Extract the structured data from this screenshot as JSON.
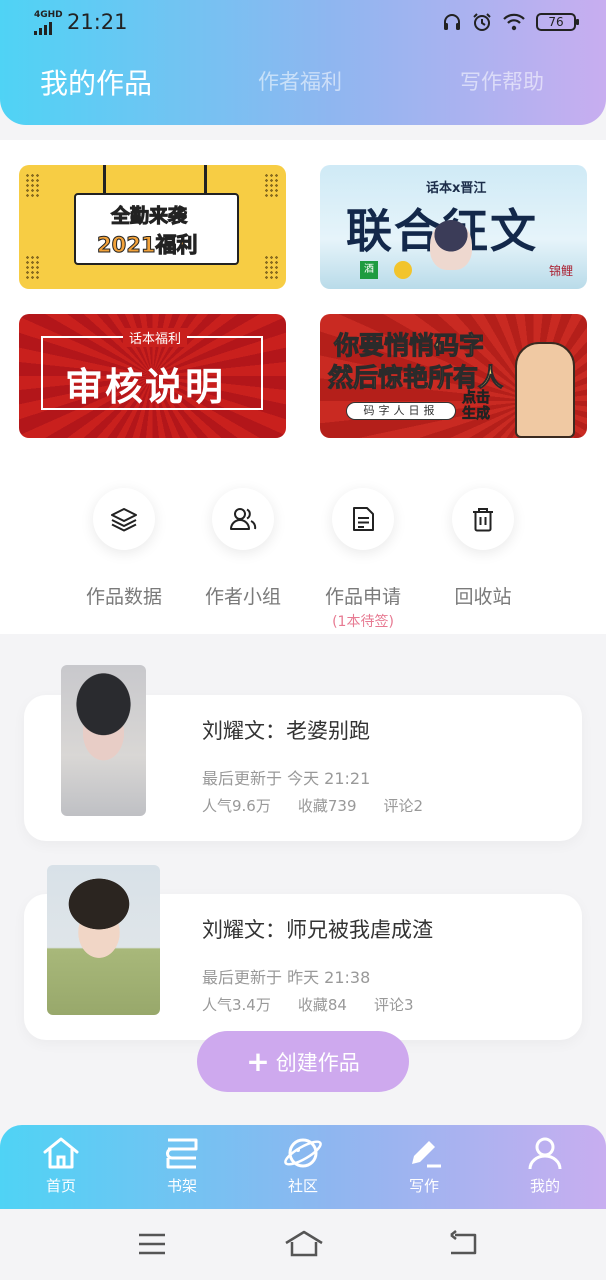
{
  "status_bar": {
    "network": "4GHD",
    "time": "21:21",
    "battery": "76"
  },
  "header_tabs": [
    {
      "label": "我的作品",
      "active": true
    },
    {
      "label": "作者福利",
      "active": false
    },
    {
      "label": "写作帮助",
      "active": false
    }
  ],
  "banners": [
    {
      "name": "attendance-banner",
      "line1": "全勤来袭",
      "line2": "2021福利"
    },
    {
      "name": "collab-banner",
      "line1": "话本x晋江",
      "line2": "联合征文",
      "logo": "酒",
      "signature": "锦鲤"
    },
    {
      "name": "review-banner",
      "line1": "话本福利",
      "line2": "审核说明"
    },
    {
      "name": "daily-banner",
      "line1": "你要悄悄码字",
      "line2": "然后惊艳所有人",
      "tag": "码字人日报",
      "cta": "点击生成"
    }
  ],
  "actions": [
    {
      "label": "作品数据",
      "icon": "layers-icon"
    },
    {
      "label": "作者小组",
      "icon": "group-icon"
    },
    {
      "label": "作品申请",
      "icon": "document-icon",
      "sub": "(1本待签)"
    },
    {
      "label": "回收站",
      "icon": "trash-icon"
    }
  ],
  "works": [
    {
      "title": "刘耀文：老婆别跑",
      "updated": "最后更新于 今天 21:21",
      "popularity": "人气9.6万",
      "favorites": "收藏739",
      "comments": "评论2"
    },
    {
      "title": "刘耀文：师兄被我虐成渣",
      "updated": "最后更新于 昨天 21:38",
      "popularity": "人气3.4万",
      "favorites": "收藏84",
      "comments": "评论3"
    }
  ],
  "create_button": {
    "plus": "+",
    "label": "创建作品"
  },
  "bottom_nav": [
    {
      "label": "首页",
      "icon": "home-icon"
    },
    {
      "label": "书架",
      "icon": "bookshelf-icon"
    },
    {
      "label": "社区",
      "icon": "planet-icon"
    },
    {
      "label": "写作",
      "icon": "pen-icon"
    },
    {
      "label": "我的",
      "icon": "user-icon"
    }
  ],
  "colors": {
    "gradient_start": "#4fd3f5",
    "gradient_end": "#c8aef0",
    "create_button": "#cea9ee",
    "pending_text": "#e77a92"
  }
}
